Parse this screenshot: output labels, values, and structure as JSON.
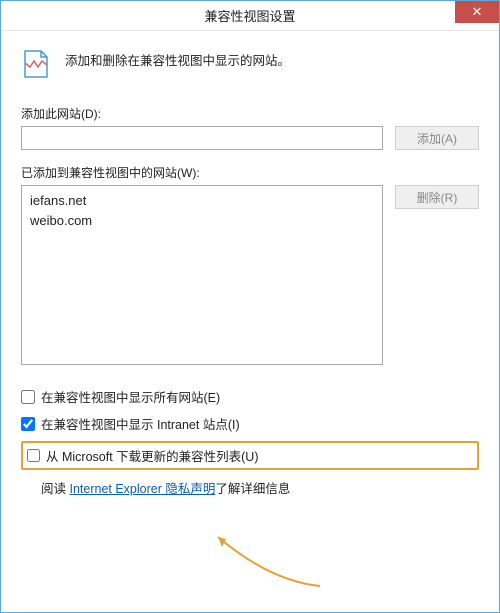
{
  "window": {
    "title": "兼容性视图设置"
  },
  "header": {
    "description": "添加和删除在兼容性视图中显示的网站。"
  },
  "add_section": {
    "label": "添加此网站(D):",
    "value": "",
    "add_button": "添加(A)"
  },
  "list_section": {
    "label": "已添加到兼容性视图中的网站(W):",
    "items": [
      "iefans.net",
      "weibo.com"
    ],
    "remove_button": "删除(R)"
  },
  "options": {
    "show_all": {
      "label": "在兼容性视图中显示所有网站(E)",
      "checked": false
    },
    "show_intranet": {
      "label": "在兼容性视图中显示 Intranet 站点(I)",
      "checked": true
    },
    "download_list": {
      "label": "从 Microsoft 下载更新的兼容性列表(U)",
      "checked": false
    }
  },
  "privacy": {
    "prefix": "阅读 ",
    "link": "Internet Explorer 隐私声明",
    "suffix": "了解详细信息"
  }
}
